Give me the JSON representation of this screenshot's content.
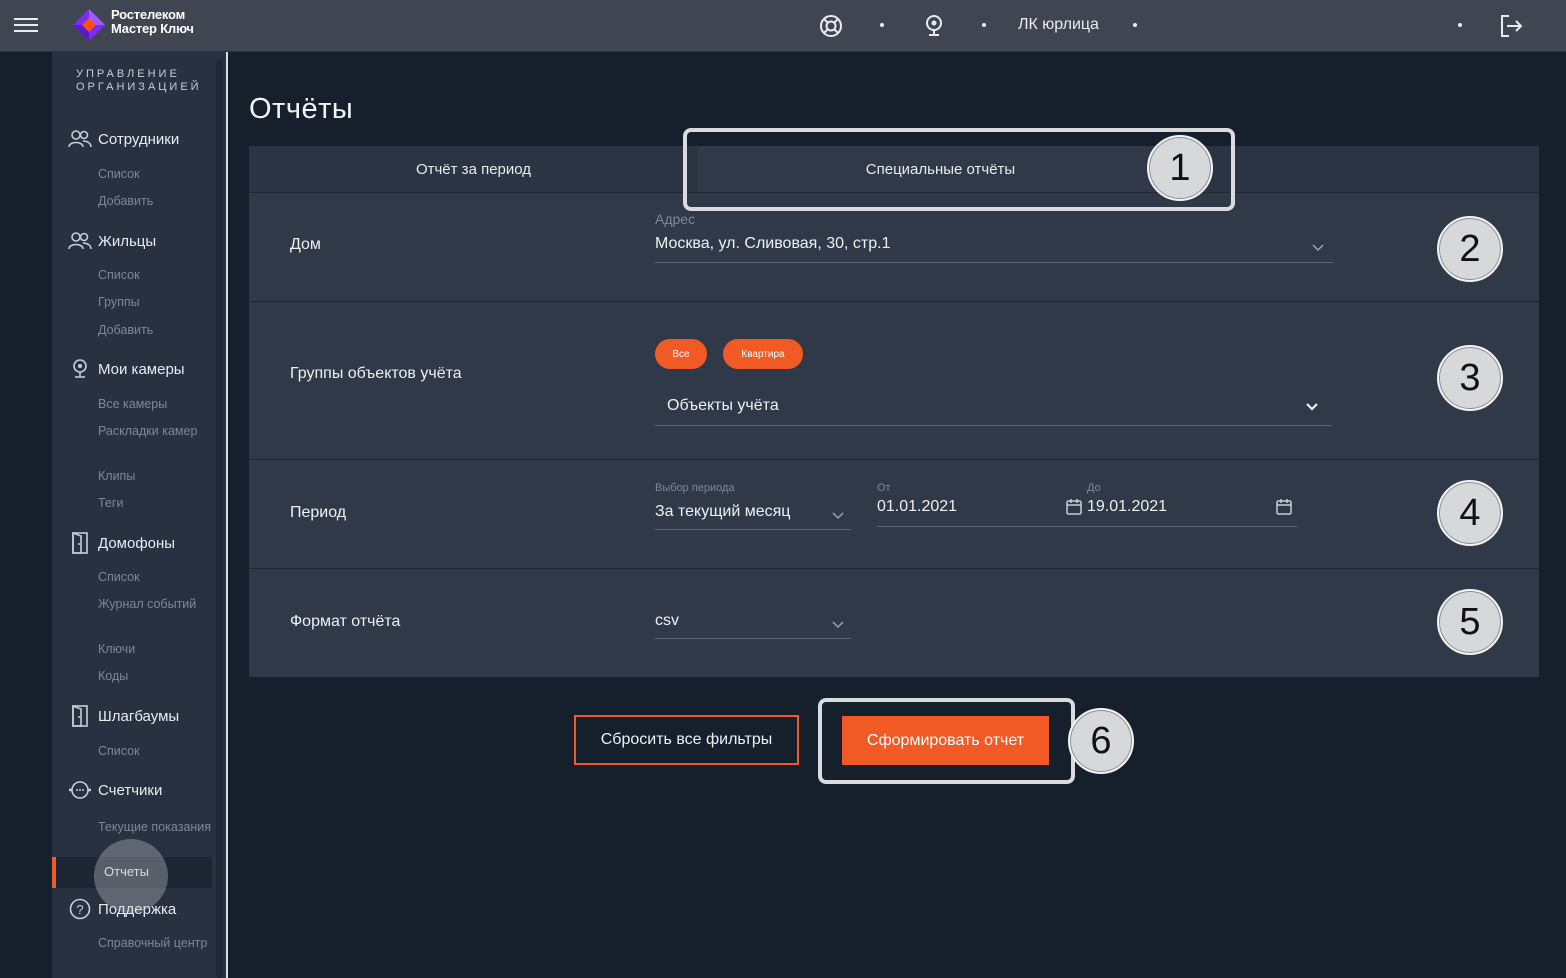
{
  "header": {
    "brand_line1": "Ростелеком",
    "brand_line2": "Мастер Ключ",
    "account_label": "ЛК юрлица",
    "icons": [
      "menu-icon",
      "support-lifebuoy-icon",
      "camera-icon",
      "logout-icon"
    ]
  },
  "sidebar": {
    "heading_line1": "УПРАВЛЕНИЕ",
    "heading_line2": "ОРГАНИЗАЦИЕЙ",
    "sections": {
      "employees": {
        "label": "Сотрудники",
        "items": [
          "Список",
          "Добавить"
        ]
      },
      "residents": {
        "label": "Жильцы",
        "items": [
          "Список",
          "Группы",
          "Добавить"
        ]
      },
      "cameras": {
        "label": "Мои камеры",
        "items": [
          "Все камеры",
          "Раскладки камер",
          "Клипы",
          "Теги"
        ]
      },
      "intercoms": {
        "label": "Домофоны",
        "items": [
          "Список",
          "Журнал событий",
          "Ключи",
          "Коды"
        ]
      },
      "barriers": {
        "label": "Шлагбаумы",
        "items": [
          "Список"
        ]
      },
      "meters": {
        "label": "Счетчики",
        "items": [
          "Текущие показания",
          "Отчеты"
        ]
      },
      "support": {
        "label": "Поддержка",
        "items": [
          "Справочный центр"
        ]
      }
    },
    "active_item": "Отчеты"
  },
  "main": {
    "title": "Отчёты",
    "tabs": [
      {
        "label": "Отчёт за период",
        "active": false
      },
      {
        "label": "Специальные отчёты",
        "active": true
      }
    ],
    "house": {
      "label": "Дом",
      "field_label": "Адрес",
      "value": "Москва, ул. Сливовая, 30, стр.1"
    },
    "groups": {
      "label": "Группы объектов учёта",
      "chips": [
        "Все",
        "Квартира"
      ],
      "select_value": "Объекты учёта"
    },
    "period": {
      "label": "Период",
      "select_label": "Выбор периода",
      "select_value": "За текущий месяц",
      "from_label": "От",
      "from_value": "01.01.2021",
      "to_label": "До",
      "to_value": "19.01.2021"
    },
    "format": {
      "label": "Формат отчёта",
      "value": "csv"
    },
    "buttons": {
      "reset": "Сбросить все фильтры",
      "submit": "Сформировать отчет"
    }
  },
  "annotations": [
    "1",
    "2",
    "3",
    "4",
    "5",
    "6"
  ],
  "colors": {
    "accent": "#f15a24",
    "topbar": "#3f4652",
    "sidebar": "#273140",
    "panel": "#2f3948",
    "background": "#16202d"
  }
}
